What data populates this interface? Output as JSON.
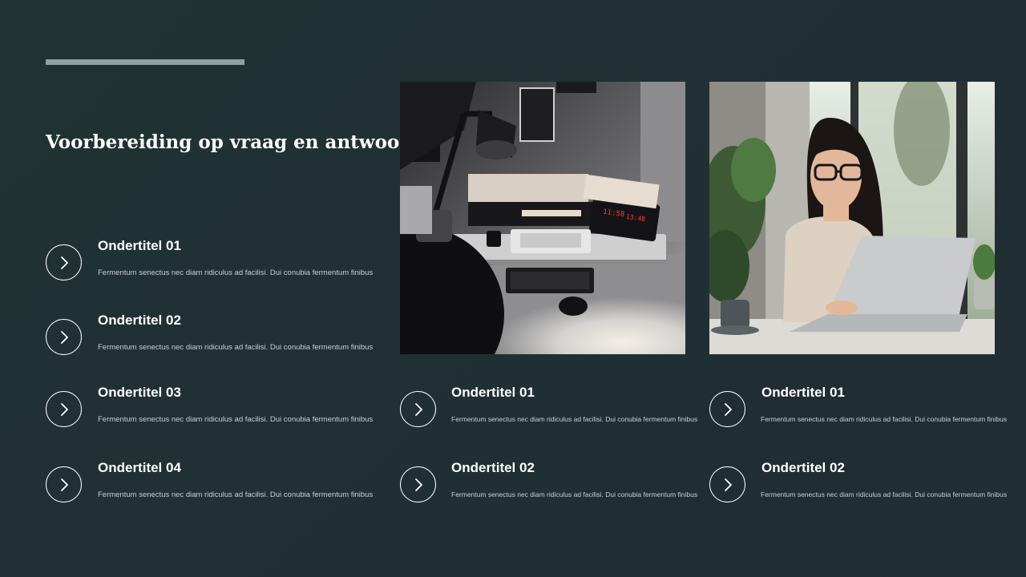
{
  "slide": {
    "title": "Voorbereiding op vraag en antwoord"
  },
  "left_items": [
    {
      "title": "Ondertitel 01",
      "desc": "Fermentum senectus nec diam ridiculus ad facilisi. Dui conubia fermentum finibus"
    },
    {
      "title": "Ondertitel 02",
      "desc": "Fermentum senectus nec diam ridiculus ad facilisi. Dui conubia fermentum finibus"
    },
    {
      "title": "Ondertitel 03",
      "desc": "Fermentum senectus nec diam ridiculus ad facilisi. Dui conubia fermentum finibus"
    },
    {
      "title": "Ondertitel 04",
      "desc": "Fermentum senectus nec diam ridiculus ad facilisi. Dui conubia fermentum finibus"
    }
  ],
  "middle_items": [
    {
      "title": "Ondertitel 01",
      "desc": "Fermentum senectus nec diam ridiculus ad facilisi. Dui conubia fermentum finibus"
    },
    {
      "title": "Ondertitel 02",
      "desc": "Fermentum senectus nec diam ridiculus ad facilisi. Dui conubia fermentum finibus"
    }
  ],
  "right_items": [
    {
      "title": "Ondertitel 01",
      "desc": "Fermentum senectus nec diam ridiculus ad facilisi. Dui conubia fermentum finibus"
    },
    {
      "title": "Ondertitel 02",
      "desc": "Fermentum senectus nec diam ridiculus ad facilisi. Dui conubia fermentum finibus"
    }
  ],
  "photos": {
    "desk_clock_time_1": "11:58",
    "desk_clock_time_2": "13:48"
  },
  "icons": {
    "item_icon": "chevron-right-icon"
  },
  "colors": {
    "background": "#203232",
    "accent_bar": "#8fa1a1",
    "text": "#ffffff",
    "desc_text": "#c9d0d0"
  }
}
